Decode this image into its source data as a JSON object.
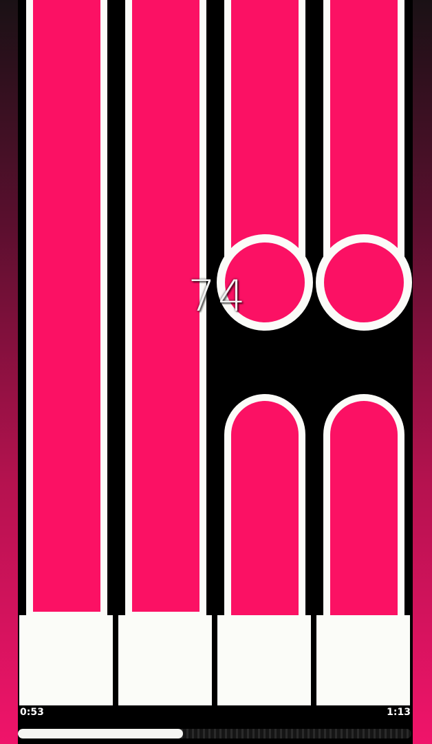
{
  "game": {
    "combo": "74",
    "time_elapsed": "0:53",
    "time_total": "1:13",
    "progress_fraction": 0.42
  },
  "colors": {
    "tile": "#fb1164",
    "outline": "#fbfbf8",
    "background": "#000000"
  },
  "lanes": [
    {
      "note": "long-tile"
    },
    {
      "note": "long-tile"
    },
    {
      "note": "tile-ending-ball"
    },
    {
      "note": "tile-ending-ball"
    }
  ]
}
